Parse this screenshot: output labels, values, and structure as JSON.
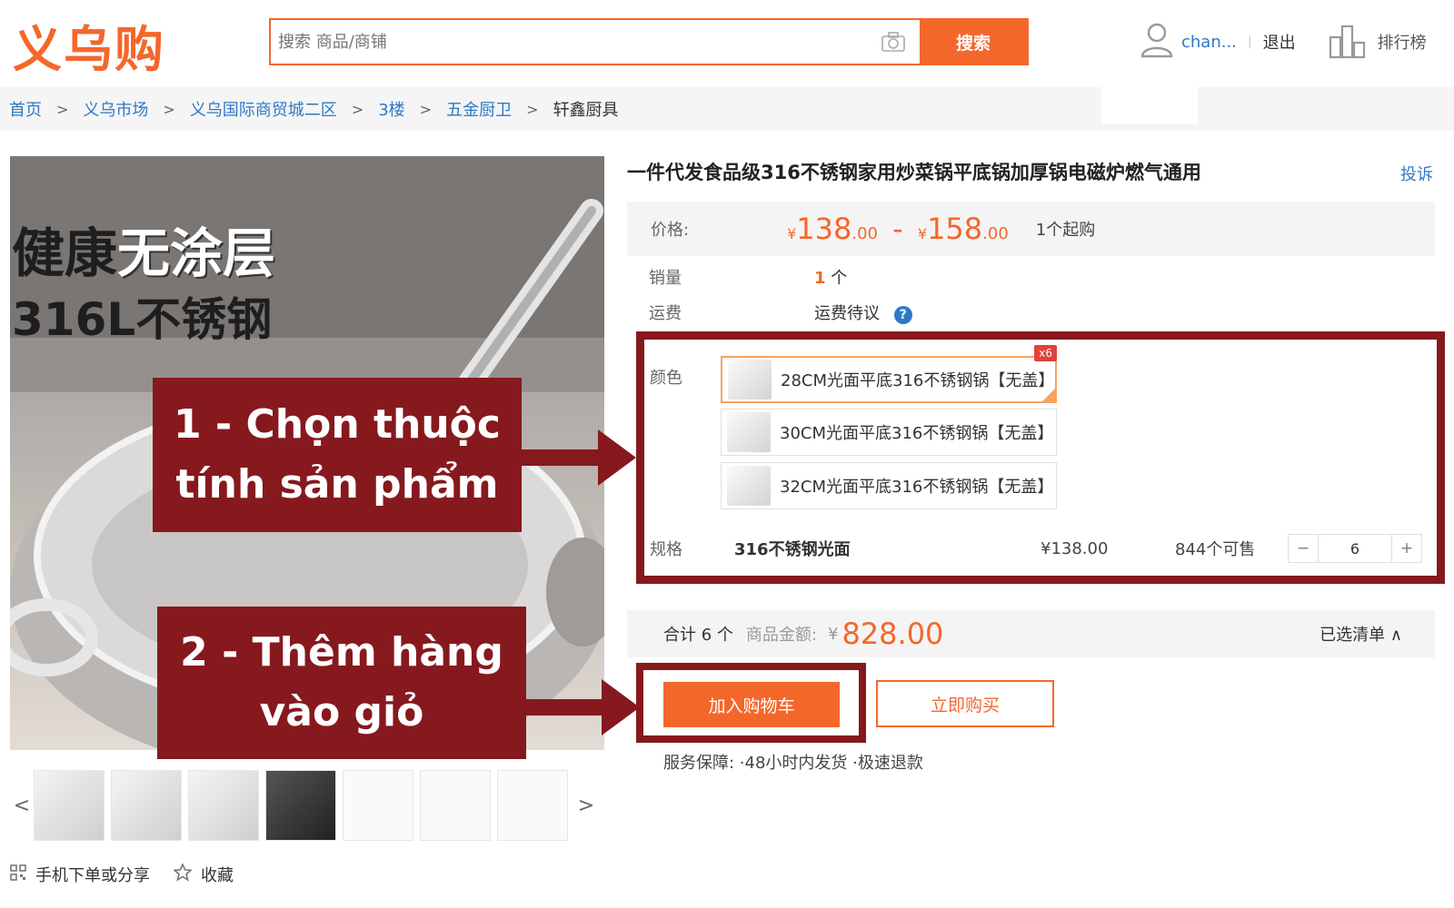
{
  "header": {
    "logo": "义乌购",
    "search_placeholder": "搜索 商品/商铺",
    "search_button": "搜索",
    "username": "chan...",
    "logout": "退出",
    "ranking": "排行榜"
  },
  "breadcrumb": {
    "items": [
      "首页",
      "义乌市场",
      "义乌国际商贸城二区",
      "3楼",
      "五金厨卫"
    ],
    "current": "轩鑫厨具"
  },
  "image": {
    "text_line1_a": "健康",
    "text_line1_b": "无涂层",
    "text_line2": "316L不锈钢"
  },
  "callouts": {
    "step1_line1": "1 - Chọn thuộc",
    "step1_line2": "tính sản phẩm",
    "step2_line1": "2 - Thêm hàng",
    "step2_line2": "vào giỏ"
  },
  "thumbs": {
    "prev": "<",
    "next": ">",
    "count": 7
  },
  "share": {
    "mobile": "手机下单或分享",
    "favorite": "收藏"
  },
  "product": {
    "title": "一件代发食品级316不锈钢家用炒菜锅平底锅加厚锅电磁炉燃气通用",
    "complain": "投诉",
    "price_label": "价格:",
    "price_low": "138",
    "price_low_dec": ".00",
    "price_high": "158",
    "price_high_dec": ".00",
    "price_sep": "-",
    "yen": "¥",
    "moq": "1个起购",
    "sales_label": "销量",
    "sales_value": "1",
    "sales_unit": "个",
    "shipping_label": "运费",
    "shipping_value": "运费待议"
  },
  "properties": {
    "color_label": "颜色",
    "options": [
      {
        "label": "28CM光面平底316不锈钢锅【无盖】",
        "selected": true,
        "badge": "x6"
      },
      {
        "label": "30CM光面平底316不锈钢锅【无盖】",
        "selected": false
      },
      {
        "label": "32CM光面平底316不锈钢锅【无盖】",
        "selected": false
      }
    ],
    "spec_label": "规格",
    "spec_value": "316不锈钢光面",
    "spec_price": "¥138.00",
    "stock": "844个可售",
    "quantity": "6"
  },
  "summary": {
    "total": "合计 6 个",
    "amount_label": "商品金额:",
    "amount_yen": "¥",
    "amount": "828.00",
    "chosen": "已选清单 ∧"
  },
  "actions": {
    "add_to_cart": "加入购物车",
    "buy_now": "立即购买"
  },
  "service": "服务保障:  ·48小时内发货   ·极速退款",
  "colors": {
    "accent": "#f4672b",
    "link": "#2f78c6",
    "callout": "#86191e"
  }
}
